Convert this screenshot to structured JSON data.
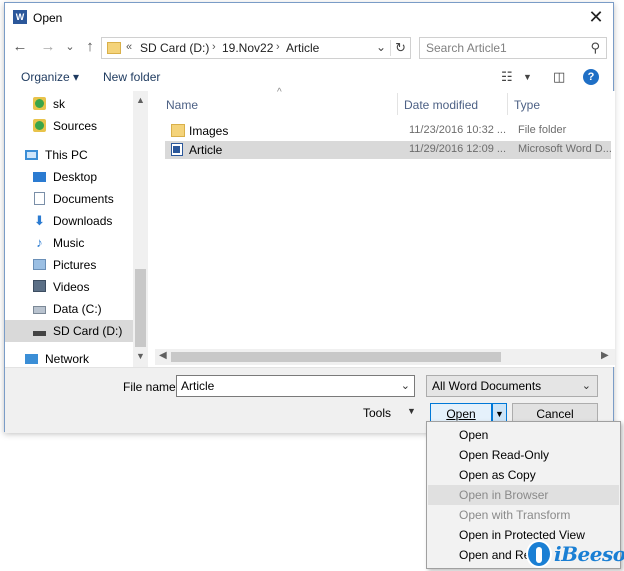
{
  "window": {
    "title": "Open",
    "app_icon_letter": "W",
    "close_glyph": "✕"
  },
  "navigation": {
    "back_glyph": "←",
    "forward_glyph": "→",
    "recent_glyph": "⌄",
    "up_glyph": "↑",
    "address": {
      "overflow": "«",
      "segments": [
        "SD Card (D:)",
        "19.Nov22",
        "Article"
      ],
      "separator": "›"
    },
    "search_placeholder": "Search Article1"
  },
  "toolbar": {
    "organize": "Organize ▾",
    "new_folder": "New folder"
  },
  "nav_pane": {
    "items": [
      {
        "label": "sk",
        "icon": "green-folder-icon"
      },
      {
        "label": "Sources",
        "icon": "green-folder-icon"
      },
      {
        "label": "This PC",
        "icon": "computer-icon"
      },
      {
        "label": "Desktop",
        "icon": "desktop-icon"
      },
      {
        "label": "Documents",
        "icon": "documents-icon"
      },
      {
        "label": "Downloads",
        "icon": "downloads-icon"
      },
      {
        "label": "Music",
        "icon": "music-icon"
      },
      {
        "label": "Pictures",
        "icon": "pictures-icon"
      },
      {
        "label": "Videos",
        "icon": "videos-icon"
      },
      {
        "label": "Data (C:)",
        "icon": "drive-icon"
      },
      {
        "label": "SD Card (D:)",
        "icon": "sd-card-icon",
        "selected": true
      },
      {
        "label": "Network",
        "icon": "network-icon"
      }
    ]
  },
  "files": {
    "columns": [
      "Name",
      "Date modified",
      "Type"
    ],
    "rows": [
      {
        "name": "Images",
        "date": "11/23/2016 10:32 ...",
        "type": "File folder",
        "icon": "folder-icon"
      },
      {
        "name": "Article",
        "date": "11/29/2016 12:09 ...",
        "type": "Microsoft Word D...",
        "icon": "word-document-icon",
        "selected": true
      }
    ]
  },
  "bottom": {
    "file_name_label": "File name:",
    "file_name_value": "Article",
    "file_type_value": "All Word Documents",
    "tools_label": "Tools",
    "open_label": "Open",
    "cancel_label": "Cancel"
  },
  "open_menu": {
    "items": [
      {
        "label": "Open",
        "enabled": true
      },
      {
        "label": "Open Read-Only",
        "enabled": true
      },
      {
        "label": "Open as Copy",
        "enabled": true
      },
      {
        "label": "Open in Browser",
        "enabled": false,
        "highlighted": true
      },
      {
        "label": "Open with Transform",
        "enabled": false
      },
      {
        "label": "Open in Protected View",
        "enabled": true
      },
      {
        "label": "Open and Rep",
        "enabled": true
      }
    ]
  },
  "watermark": {
    "text": "iBeesoft"
  },
  "colors": {
    "accent": "#0078d7",
    "selection": "#d9d9d9",
    "header_text": "#4d6185",
    "watermark": "#1a7fd4"
  }
}
